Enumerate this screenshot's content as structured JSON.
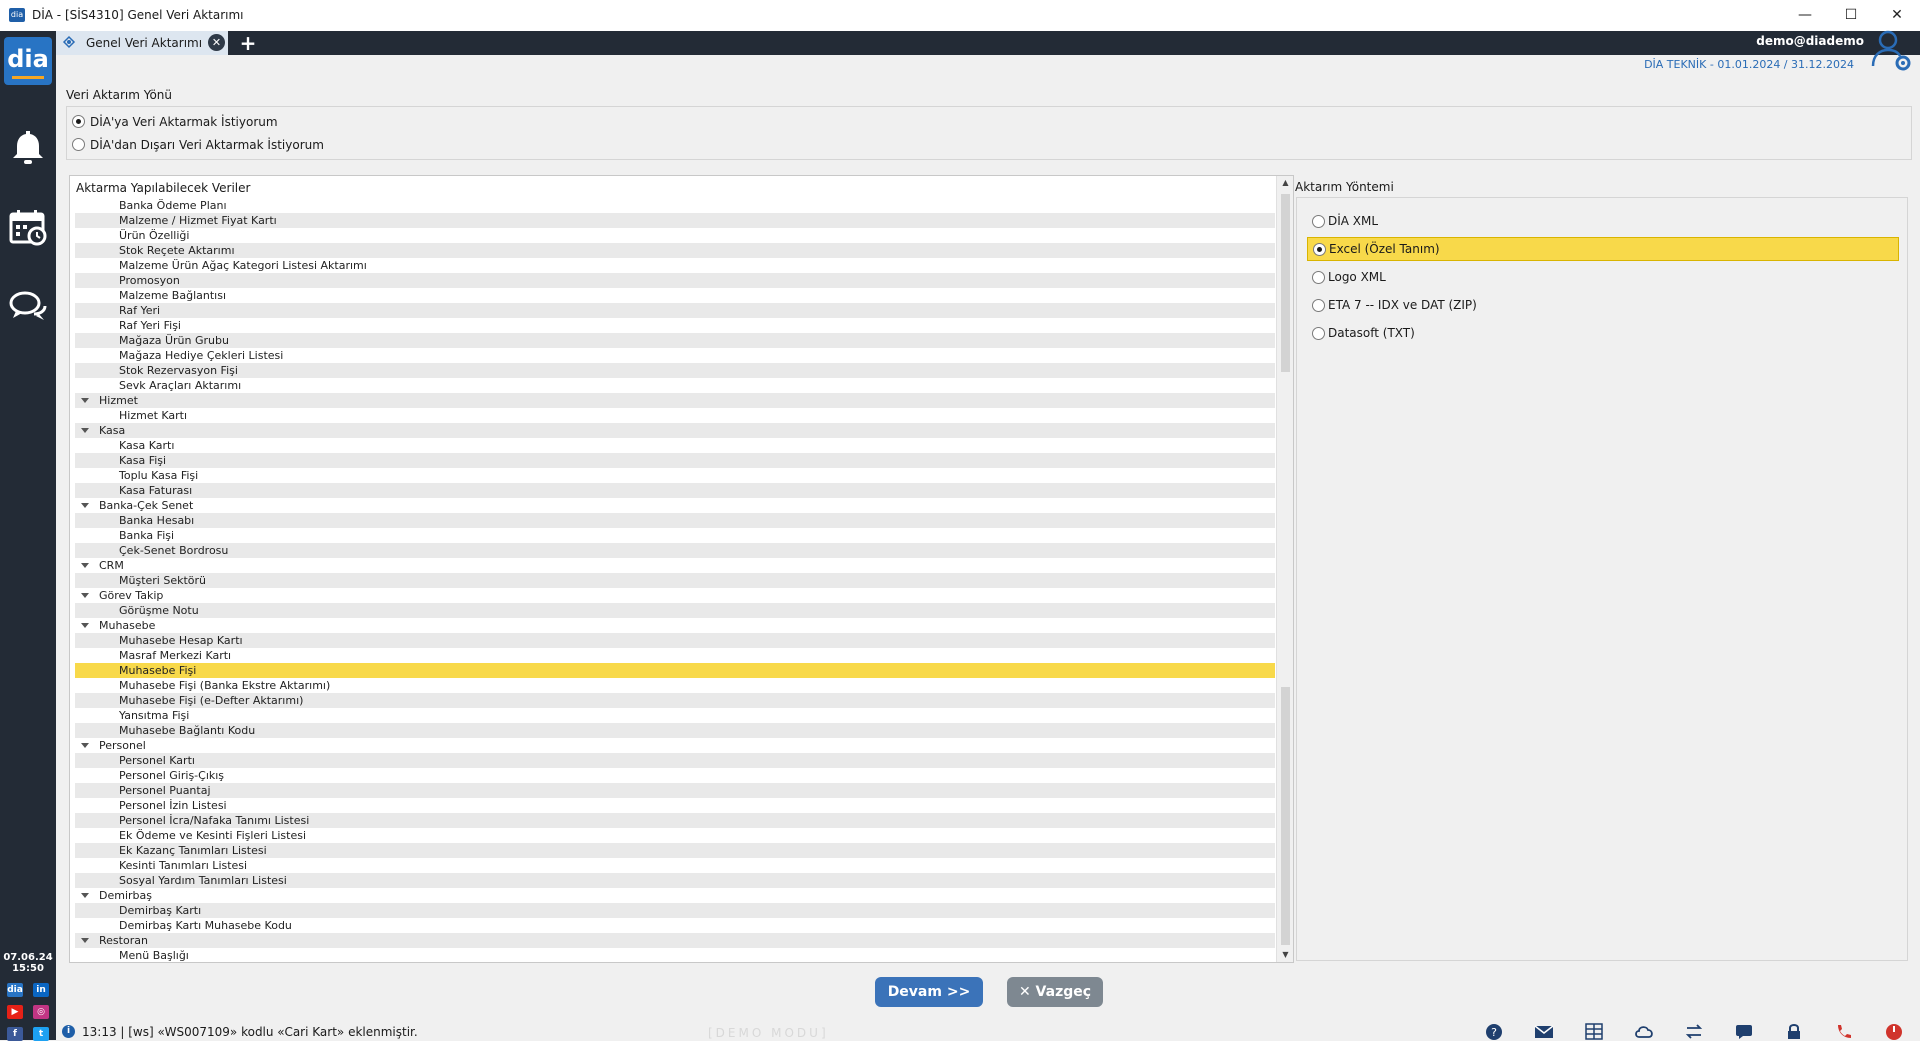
{
  "window": {
    "title": "DİA - [SİS4310] Genel Veri Aktarımı",
    "app_icon_text": "dia",
    "controls": {
      "minimize": "—",
      "maximize": "☐",
      "close": "✕"
    }
  },
  "sidebar": {
    "logo_text": "dia",
    "icons": [
      "bell-icon",
      "calendar-clock-icon",
      "chat-icon"
    ],
    "date": "07.06.24",
    "time": "15:50",
    "social": {
      "dia": "dia",
      "linkedin": "in",
      "youtube": "▶",
      "instagram": "◎",
      "facebook": "f",
      "twitter": "t"
    }
  },
  "tabbar": {
    "tab_label": "Genel Veri Aktarımı",
    "close_glyph": "✕",
    "add_glyph": "+",
    "user": "demo@diademo"
  },
  "infobar": {
    "company": "DİA TEKNİK -  01.01.2024 / 31.12.2024"
  },
  "direction": {
    "legend": "Veri Aktarım Yönü",
    "options": [
      {
        "label": "DİA'ya Veri Aktarmak İstiyorum",
        "checked": true
      },
      {
        "label": "DİA'dan Dışarı Veri Aktarmak İstiyorum",
        "checked": false
      }
    ]
  },
  "tree": {
    "header": "Aktarma Yapılabilecek Veriler",
    "rows": [
      {
        "label": "Banka Ödeme Planı",
        "level": 1
      },
      {
        "label": "Malzeme / Hizmet Fiyat Kartı",
        "level": 1
      },
      {
        "label": "Ürün Özelliği",
        "level": 1
      },
      {
        "label": "Stok Reçete Aktarımı",
        "level": 1
      },
      {
        "label": "Malzeme Ürün Ağaç Kategori Listesi Aktarımı",
        "level": 1
      },
      {
        "label": "Promosyon",
        "level": 1
      },
      {
        "label": "Malzeme Bağlantısı",
        "level": 1
      },
      {
        "label": "Raf Yeri",
        "level": 1
      },
      {
        "label": "Raf Yeri Fişi",
        "level": 1
      },
      {
        "label": "Mağaza Ürün Grubu",
        "level": 1
      },
      {
        "label": "Mağaza Hediye Çekleri Listesi",
        "level": 1
      },
      {
        "label": "Stok Rezervasyon Fişi",
        "level": 1
      },
      {
        "label": "Sevk Araçları Aktarımı",
        "level": 1
      },
      {
        "label": "Hizmet",
        "level": 0
      },
      {
        "label": "Hizmet Kartı",
        "level": 1
      },
      {
        "label": "Kasa",
        "level": 0
      },
      {
        "label": "Kasa Kartı",
        "level": 1
      },
      {
        "label": "Kasa Fişi",
        "level": 1
      },
      {
        "label": "Toplu Kasa Fişi",
        "level": 1
      },
      {
        "label": "Kasa Faturası",
        "level": 1
      },
      {
        "label": "Banka-Çek Senet",
        "level": 0
      },
      {
        "label": "Banka Hesabı",
        "level": 1
      },
      {
        "label": "Banka Fişi",
        "level": 1
      },
      {
        "label": "Çek-Senet Bordrosu",
        "level": 1
      },
      {
        "label": "CRM",
        "level": 0
      },
      {
        "label": "Müşteri Sektörü",
        "level": 1
      },
      {
        "label": "Görev Takip",
        "level": 0
      },
      {
        "label": "Görüşme Notu",
        "level": 1
      },
      {
        "label": "Muhasebe",
        "level": 0
      },
      {
        "label": "Muhasebe Hesap Kartı",
        "level": 1
      },
      {
        "label": "Masraf Merkezi Kartı",
        "level": 1
      },
      {
        "label": "Muhasebe Fişi",
        "level": 1,
        "selected": true
      },
      {
        "label": "Muhasebe Fişi (Banka Ekstre Aktarımı)",
        "level": 1
      },
      {
        "label": "Muhasebe Fişi (e-Defter Aktarımı)",
        "level": 1
      },
      {
        "label": "Yansıtma Fişi",
        "level": 1
      },
      {
        "label": "Muhasebe Bağlantı Kodu",
        "level": 1
      },
      {
        "label": "Personel",
        "level": 0
      },
      {
        "label": "Personel Kartı",
        "level": 1
      },
      {
        "label": "Personel Giriş-Çıkış",
        "level": 1
      },
      {
        "label": "Personel Puantaj",
        "level": 1
      },
      {
        "label": "Personel İzin Listesi",
        "level": 1
      },
      {
        "label": "Personel İcra/Nafaka Tanımı Listesi",
        "level": 1
      },
      {
        "label": "Ek Ödeme ve Kesinti Fişleri Listesi",
        "level": 1
      },
      {
        "label": "Ek Kazanç Tanımları Listesi",
        "level": 1
      },
      {
        "label": "Kesinti Tanımları Listesi",
        "level": 1
      },
      {
        "label": "Sosyal Yardım Tanımları Listesi",
        "level": 1
      },
      {
        "label": "Demirbaş",
        "level": 0
      },
      {
        "label": "Demirbaş Kartı",
        "level": 1
      },
      {
        "label": "Demirbaş Kartı Muhasebe Kodu",
        "level": 1
      },
      {
        "label": "Restoran",
        "level": 0
      },
      {
        "label": "Menü Başlığı",
        "level": 1
      }
    ]
  },
  "method": {
    "legend": "Aktarım Yöntemi",
    "options": [
      {
        "label": "DİA XML",
        "checked": false
      },
      {
        "label": "Excel (Özel Tanım)",
        "checked": true
      },
      {
        "label": "Logo XML",
        "checked": false
      },
      {
        "label": "ETA 7 -- IDX ve DAT (ZIP)",
        "checked": false
      },
      {
        "label": "Datasoft (TXT)",
        "checked": false
      }
    ]
  },
  "buttons": {
    "next": "Devam >>",
    "cancel": "✕ Vazgeç"
  },
  "statusbar": {
    "info_glyph": "i",
    "message": "13:13 | [ws] «WS007109» kodlu «Cari Kart» eklenmiştir.",
    "demo_mode": "[DEMO MODU]",
    "icons": [
      "help-icon",
      "mail-icon",
      "calculator-icon",
      "cloud-sync-icon",
      "transfer-icon",
      "message-icon",
      "lock-icon",
      "phone-icon",
      "power-icon"
    ]
  },
  "colors": {
    "selection": "#f8d94a",
    "sidebar": "#232b36",
    "accent": "#3b73b9"
  }
}
